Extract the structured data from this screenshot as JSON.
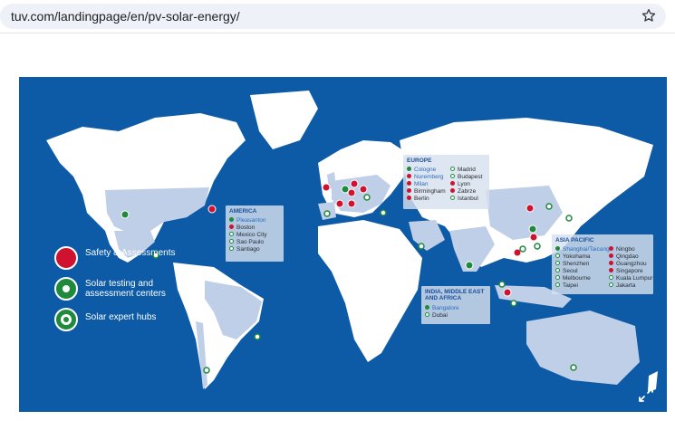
{
  "browser": {
    "url": "tuv.com/landingpage/en/pv-solar-energy/",
    "bookmark_icon": "star-icon"
  },
  "colors": {
    "ocean": "#0d5aa6",
    "land": "#ffffff",
    "highlight_land": "#bfcfe8",
    "safety_red": "#cf1230",
    "testing_green": "#1f8a3b"
  },
  "legend": {
    "safety": "Safety & Assessments",
    "testing": "Solar testing and assessment centers",
    "experts": "Solar expert hubs"
  },
  "regions": {
    "america": {
      "title": "AMERICA",
      "cities": [
        {
          "name": "Pleasanton",
          "marker": "testing",
          "highlight": true
        },
        {
          "name": "Boston",
          "marker": "safety",
          "highlight": false
        },
        {
          "name": "Mexico City",
          "marker": "expert",
          "highlight": false
        },
        {
          "name": "Sao Paulo",
          "marker": "expert",
          "highlight": false
        },
        {
          "name": "Santiago",
          "marker": "expert",
          "highlight": false
        }
      ]
    },
    "europe": {
      "title": "EUROPE",
      "col1": [
        {
          "name": "Cologne",
          "marker": "testing",
          "highlight": true
        },
        {
          "name": "Nuremberg",
          "marker": "safety",
          "highlight": true
        },
        {
          "name": "Milan",
          "marker": "safety",
          "highlight": true
        },
        {
          "name": "Birmingham",
          "marker": "safety",
          "highlight": false
        },
        {
          "name": "Berlin",
          "marker": "safety",
          "highlight": false
        }
      ],
      "col2": [
        {
          "name": "Madrid",
          "marker": "expert",
          "highlight": false
        },
        {
          "name": "Budapest",
          "marker": "expert",
          "highlight": false
        },
        {
          "name": "Lyon",
          "marker": "safety",
          "highlight": false
        },
        {
          "name": "Zabrze",
          "marker": "safety",
          "highlight": false
        },
        {
          "name": "Istanbul",
          "marker": "expert",
          "highlight": false
        }
      ]
    },
    "india": {
      "title": "INDIA, MIDDLE EAST AND AFRICA",
      "cities": [
        {
          "name": "Bangalore",
          "marker": "testing",
          "highlight": true
        },
        {
          "name": "Dubai",
          "marker": "expert",
          "highlight": false
        }
      ]
    },
    "asia": {
      "title": "ASIA PACIFIC",
      "col1": [
        {
          "name": "Shanghai/Taicang",
          "marker": "testing",
          "highlight": true
        },
        {
          "name": "Yokohama",
          "marker": "expert",
          "highlight": false
        },
        {
          "name": "Shenzhen",
          "marker": "expert",
          "highlight": false
        },
        {
          "name": "Seoul",
          "marker": "expert",
          "highlight": false
        },
        {
          "name": "Melbourne",
          "marker": "expert",
          "highlight": false
        },
        {
          "name": "Taipei",
          "marker": "expert",
          "highlight": false
        }
      ],
      "col2": [
        {
          "name": "Ningbo",
          "marker": "safety",
          "highlight": false
        },
        {
          "name": "Qingdao",
          "marker": "safety",
          "highlight": false
        },
        {
          "name": "Guangzhou",
          "marker": "safety",
          "highlight": false
        },
        {
          "name": "Singapore",
          "marker": "safety",
          "highlight": false
        },
        {
          "name": "Kuala Lumpur",
          "marker": "expert",
          "highlight": false
        },
        {
          "name": "Jakarta",
          "marker": "expert",
          "highlight": false
        }
      ]
    }
  },
  "resize_icon": "expand-icon"
}
